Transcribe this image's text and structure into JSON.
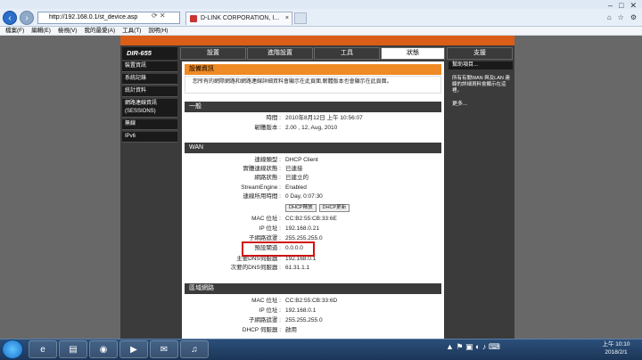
{
  "browser": {
    "address": "http://192.168.0.1/st_device.asp",
    "tab_title": "D-LINK CORPORATION, I...",
    "menu": [
      "檔案(F)",
      "編輯(E)",
      "檢視(V)",
      "我的最愛(A)",
      "工具(T)",
      "說明(H)"
    ]
  },
  "router": {
    "brand": "DIR-655",
    "nav_tabs": [
      "設置",
      "進階設置",
      "工具",
      "狀態",
      "支援"
    ],
    "sidebar": [
      "裝置資訊",
      "系統記錄",
      "統計資料",
      "網路連線資訊 (SESSIONS)",
      "無線",
      "IPv6"
    ]
  },
  "device_info": {
    "title": "設備資訊",
    "description": "您所有的網際網路和網路連線詳細資料會顯示在此頁面,韌體版本也會顯示在此頁面。"
  },
  "general": {
    "title": "一般",
    "time_label": "時間 :",
    "time_value": "2010年8月12日 上午 10:56:07",
    "firmware_label": "韌體版本 :",
    "firmware_value": "2.00 , 12, Aug, 2010"
  },
  "wan": {
    "title": "WAN",
    "rows": [
      {
        "label": "連線類型 :",
        "value": "DHCP Client"
      },
      {
        "label": "實體連線狀態 :",
        "value": "已連接"
      },
      {
        "label": "網路狀態 :",
        "value": "已建立的"
      },
      {
        "label": "StreamEngine :",
        "value": "Enabled"
      },
      {
        "label": "連線所用時間 :",
        "value": "0 Day, 0:07:30"
      }
    ],
    "btn_release": "DHCP釋放",
    "btn_renew": "DHCP更新",
    "rows2": [
      {
        "label": "MAC 位址 :",
        "value": "CC:B2:55:CB:33:6E"
      },
      {
        "label": "IP 位址 :",
        "value": "192.168.0.21"
      },
      {
        "label": "子網路遮罩 :",
        "value": "255.255.255.0"
      },
      {
        "label": "預設閘道 :",
        "value": "0.0.0.0"
      },
      {
        "label": "主要DNS伺服器 :",
        "value": "192.168.0.1"
      },
      {
        "label": "次要的DNS伺服器 :",
        "value": "61.31.1.1"
      }
    ]
  },
  "lan": {
    "title": "區域網路",
    "rows": [
      {
        "label": "MAC 位址 :",
        "value": "CC:B2:55:CB:33:6D"
      },
      {
        "label": "IP 位址 :",
        "value": "192.168.0.1"
      },
      {
        "label": "子網路遮罩 :",
        "value": "255.255.255.0"
      },
      {
        "label": "DHCP 伺服器 :",
        "value": "啟用"
      }
    ]
  },
  "help": {
    "title": "幫助項目...",
    "text": "所有有關WAN 與及LAN 連線的詳細資料會顯示在這裡。",
    "more": "更多..."
  },
  "taskbar": {
    "time": "上午 10:10",
    "date": "2018/2/1"
  },
  "colors": {
    "orange": "#f08a24",
    "dark": "#3b3b3b",
    "highlight": "#d01010"
  }
}
